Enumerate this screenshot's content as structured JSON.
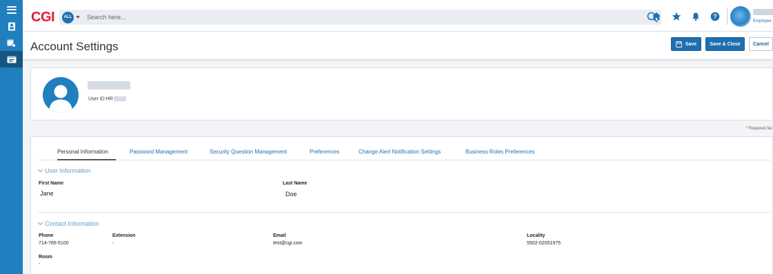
{
  "app": {
    "logo": "CGI"
  },
  "search": {
    "scope": "ALL",
    "placeholder": "Search here..."
  },
  "user_menu": {
    "role": "Employee"
  },
  "page": {
    "title": "Account Settings"
  },
  "actions": {
    "save": "Save",
    "save_close": "Save & Close",
    "cancel": "Cancel"
  },
  "profile": {
    "user_id_label": "User ID:HR"
  },
  "required_note": {
    "star": "*",
    "text": " Required fiel"
  },
  "tabs": [
    {
      "label": "Personal Information",
      "active": true
    },
    {
      "label": "Password Management",
      "active": false
    },
    {
      "label": "Security Question Management",
      "active": false
    },
    {
      "label": "Preferences",
      "active": false
    },
    {
      "label": "Change Alert Notification Settings",
      "active": false
    },
    {
      "label": "Business Roles Preferences",
      "active": false
    }
  ],
  "user_info": {
    "heading": "User Information",
    "first_name_label": "First Name",
    "first_name": "Jane",
    "last_name_label": "Last Name",
    "last_name": "Doe"
  },
  "contact_info": {
    "heading": "Contact Information",
    "phone_label": "Phone",
    "phone": "714-765-5100",
    "extension_label": "Extension",
    "extension": "-",
    "email_label": "Email",
    "email": "test@cgi.com",
    "locality_label": "Locality",
    "locality": "5502-02051975",
    "room_label": "Room",
    "room": "-"
  },
  "colors": {
    "primary": "#1f6fb0",
    "rail": "#1f7fbf",
    "logo": "#e31937"
  }
}
